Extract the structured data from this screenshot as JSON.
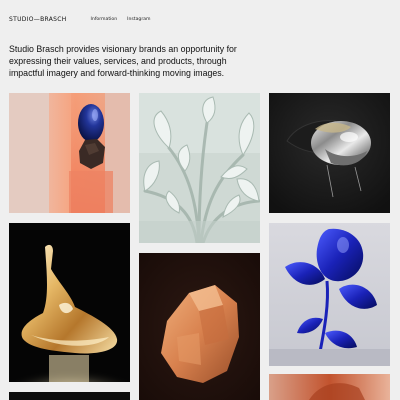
{
  "header": {
    "logo": "STUDIO—BRASCH",
    "nav": [
      {
        "label": "Information"
      },
      {
        "label": "Instagram"
      }
    ]
  },
  "intro": {
    "text": "Studio Brasch provides visionary brands an opportunity for expressing their values, services, and products, through impactful imagery and forward-thinking moving images."
  },
  "colors": {
    "background": "#efefef",
    "text": "#111111"
  },
  "gallery": {
    "tiles": [
      {
        "icon": "blue-egg-on-rock-image"
      },
      {
        "icon": "frosted-plant-image"
      },
      {
        "icon": "chrome-helmet-image"
      },
      {
        "icon": "golden-liquid-sculpture-image"
      },
      {
        "icon": "orange-rock-image"
      },
      {
        "icon": "blue-flower-sculpture-image"
      },
      {
        "icon": "dark-image"
      },
      {
        "icon": "orange-abstract-image"
      }
    ]
  }
}
